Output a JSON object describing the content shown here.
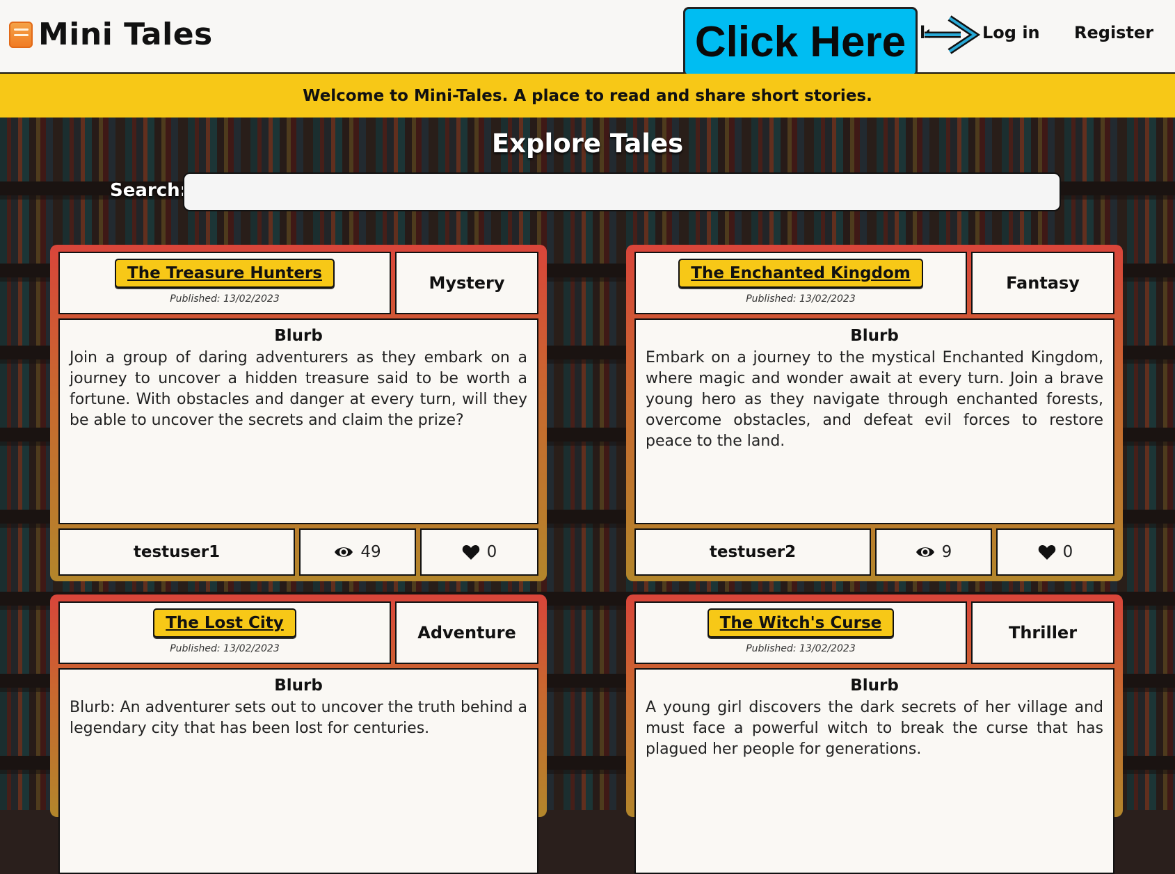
{
  "app": {
    "name": "Mini Tales"
  },
  "header": {
    "click_here": "Click Here",
    "partial_link": "lo",
    "login": "Log in",
    "register": "Register"
  },
  "banner": {
    "text": "Welcome to Mini-Tales. A place to read and share short stories."
  },
  "explore": {
    "title": "Explore Tales",
    "search_label": "Search:",
    "search_value": ""
  },
  "tales": [
    {
      "title": "The Treasure Hunters",
      "published": "Published: 13/02/2023",
      "genre": "Mystery",
      "blurb_heading": "Blurb",
      "blurb": "Join a group of daring adventurers as they embark on a journey to uncover a hidden treasure said to be worth a fortune. With obstacles and danger at every turn, will they be able to uncover the secrets and claim the prize?",
      "author": "testuser1",
      "views": "49",
      "likes": "0"
    },
    {
      "title": "The Enchanted Kingdom",
      "published": "Published: 13/02/2023",
      "genre": "Fantasy",
      "blurb_heading": "Blurb",
      "blurb": "Embark on a journey to the mystical Enchanted Kingdom, where magic and wonder await at every turn. Join a brave young hero as they navigate through enchanted forests, overcome obstacles, and defeat evil forces to restore peace to the land.",
      "author": "testuser2",
      "views": "9",
      "likes": "0"
    },
    {
      "title": "The Lost City",
      "published": "Published: 13/02/2023",
      "genre": "Adventure",
      "blurb_heading": "Blurb",
      "blurb": "Blurb: An adventurer sets out to uncover the truth behind a legendary city that has been lost for centuries."
    },
    {
      "title": "The Witch's Curse",
      "published": "Published: 13/02/2023",
      "genre": "Thriller",
      "blurb_heading": "Blurb",
      "blurb": "A young girl discovers the dark secrets of her village and must face a powerful witch to break the curse that has plagued her people for generations."
    }
  ],
  "colors": {
    "accent_yellow": "#f7c817",
    "click_here_blue": "#00bdf2",
    "card_top": "#d9453a",
    "card_bottom": "#b3862b"
  },
  "icons": {
    "logo": "book-logo-icon",
    "arrow": "arrow-right-icon",
    "views": "eye-icon",
    "likes": "heart-icon"
  }
}
